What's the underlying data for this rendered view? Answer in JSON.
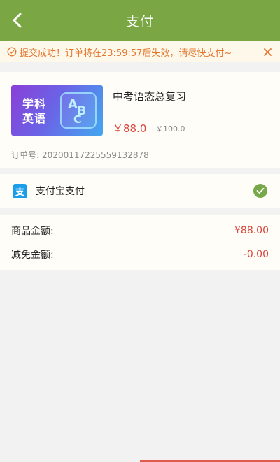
{
  "header": {
    "title": "支付",
    "back_icon": "chevron-left-icon"
  },
  "notice": {
    "text": "提交成功！订单将在23:59:57后失效，请尽快支付~",
    "icon": "clock-icon",
    "close_icon": "close-icon",
    "color": "#e5762f"
  },
  "product": {
    "cover_subject": "学科英语",
    "cover_letters": {
      "a": "A",
      "b": "B",
      "c": "C"
    },
    "title": "中考语态总复习",
    "price": "￥88.0",
    "original_price": "￥100.0",
    "order_label": "订单号:",
    "order_number": "20200117225559132878"
  },
  "payment": {
    "icon_glyph": "支",
    "label": "支付宝支付",
    "selected": true,
    "brand_color": "#1a9dea"
  },
  "amounts": [
    {
      "label": "商品金额:",
      "value": "¥88.00"
    },
    {
      "label": "减免金额:",
      "value": "-0.00"
    }
  ],
  "colors": {
    "header": "#7aa644",
    "price": "#d9443b",
    "check": "#77a84a"
  }
}
